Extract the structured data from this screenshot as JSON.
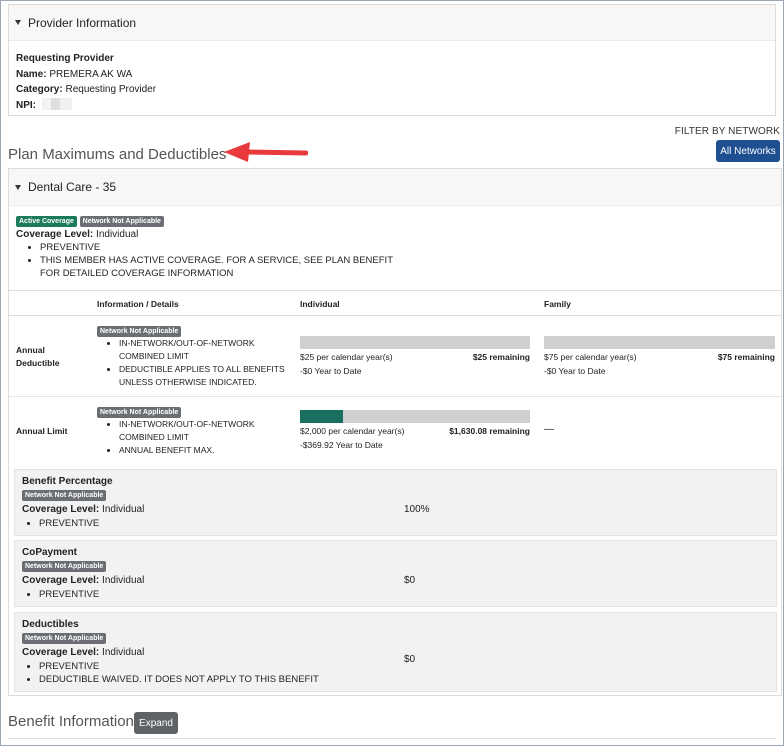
{
  "provider": {
    "header": "Provider Information",
    "section_label": "Requesting Provider",
    "name_label": "Name:",
    "name_value": "PREMERA AK WA",
    "category_label": "Category:",
    "category_value": "Requesting Provider",
    "npi_label": "NPI:"
  },
  "filter": {
    "label": "FILTER BY NETWORK",
    "button": "All Networks"
  },
  "plan_title": "Plan Maximums and Deductibles",
  "dental": {
    "header": "Dental Care - 35",
    "badge_active": "Active Coverage",
    "badge_network": "Network Not Applicable",
    "coverage_label": "Coverage Level:",
    "coverage_value": "Individual",
    "bullets": [
      "PREVENTIVE",
      "THIS MEMBER HAS ACTIVE COVERAGE. FOR A SERVICE, SEE PLAN BENEFIT",
      "FOR DETAILED COVERAGE INFORMATION"
    ]
  },
  "table": {
    "headers": [
      "Information / Details",
      "Individual",
      "Family"
    ],
    "rows": [
      {
        "label": [
          "Annual",
          "Deductible"
        ],
        "badge": "Network Not Applicable",
        "bullets": [
          "IN-NETWORK/OUT-OF-NETWORK",
          "COMBINED LIMIT",
          "DEDUCTIBLE APPLIES TO ALL BENEFITS",
          "UNLESS OTHERWISE INDICATED."
        ],
        "individual": {
          "fraction": 0.0,
          "amount": "$25 per calendar year(s)",
          "remaining": "$25 remaining",
          "ytd": "-$0 Year to Date"
        },
        "family": {
          "fraction": 0.0,
          "amount": "$75 per calendar year(s)",
          "remaining": "$75 remaining",
          "ytd": "-$0 Year to Date"
        }
      },
      {
        "label": [
          "Annual Limit"
        ],
        "badge": "Network Not Applicable",
        "bullets": [
          "IN-NETWORK/OUT-OF-NETWORK",
          "COMBINED LIMIT",
          "ANNUAL BENEFIT MAX."
        ],
        "individual": {
          "fraction": 0.185,
          "amount": "$2,000 per calendar year(s)",
          "remaining": "$1,630.08 remaining",
          "ytd": "-$369.92 Year to Date"
        },
        "family_dash": "—"
      }
    ]
  },
  "benefits": [
    {
      "title": "Benefit Percentage",
      "badge": "Network Not Applicable",
      "coverage_label": "Coverage Level:",
      "coverage_value": "Individual",
      "bullets": [
        "PREVENTIVE"
      ],
      "value": "100%"
    },
    {
      "title": "CoPayment",
      "badge": "Network Not Applicable",
      "coverage_label": "Coverage Level:",
      "coverage_value": "Individual",
      "bullets": [
        "PREVENTIVE"
      ],
      "value": "$0"
    },
    {
      "title": "Deductibles",
      "badge": "Network Not Applicable",
      "coverage_label": "Coverage Level:",
      "coverage_value": "Individual",
      "bullets": [
        "PREVENTIVE",
        "DEDUCTIBLE WAIVED. IT DOES NOT APPLY TO THIS BENEFIT"
      ],
      "value": "$0"
    }
  ],
  "benefit_info": {
    "title": "Benefit Information",
    "button": "Expand"
  },
  "colors": {
    "primary_button": "#1d4f91",
    "active_badge": "#1a7a5a",
    "network_badge": "#6b6e73",
    "meter_fill": "#1a7060",
    "annotation_arrow": "#e8393c"
  }
}
